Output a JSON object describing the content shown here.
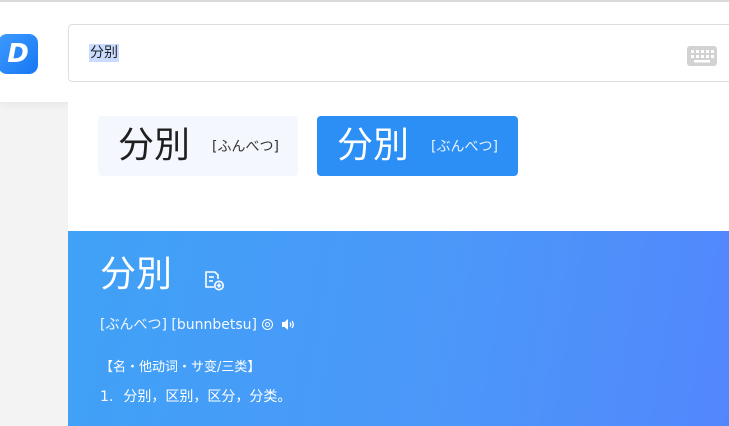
{
  "app": {
    "logo_letter": "D"
  },
  "search": {
    "query": "分别"
  },
  "candidates": [
    {
      "word": "分別",
      "reading": "[ふんべつ]"
    },
    {
      "word": "分別",
      "reading": "[ぶんべつ]"
    }
  ],
  "entry": {
    "word": "分別",
    "pronunciation": "[ぶんべつ] [bunnbetsu]",
    "part_of_speech": "【名・他动词・サ变/三类】",
    "definitions": [
      {
        "num": "1.",
        "text": "分别，区别，区分，分类。"
      }
    ]
  },
  "colors": {
    "accent": "#2b8ff5",
    "result_gradient_start": "#3fa2f6",
    "result_gradient_end": "#5287fc",
    "inactive_card": "#f4f7fd"
  },
  "icons": [
    "keyboard-icon",
    "add-to-notebook-icon",
    "circle-icon",
    "speaker-icon"
  ]
}
